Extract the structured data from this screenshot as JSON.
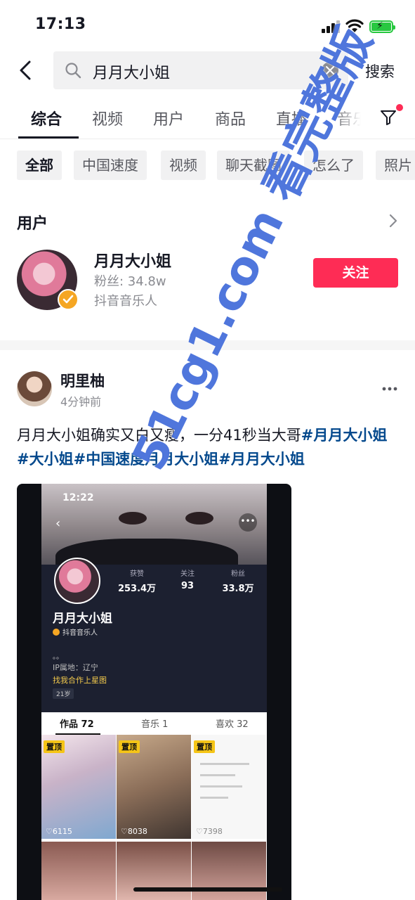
{
  "status_bar": {
    "time": "17:13"
  },
  "search": {
    "value": "月月大小姐",
    "button_label": "搜索"
  },
  "tabs": [
    {
      "label": "综合"
    },
    {
      "label": "视频"
    },
    {
      "label": "用户"
    },
    {
      "label": "商品"
    },
    {
      "label": "直播"
    },
    {
      "label": "音乐"
    }
  ],
  "chips": [
    {
      "label": "全部"
    },
    {
      "label": "中国速度"
    },
    {
      "label": "视频"
    },
    {
      "label": "聊天截图"
    },
    {
      "label": "怎么了"
    },
    {
      "label": "照片"
    }
  ],
  "user_section": {
    "title": "用户",
    "user": {
      "name": "月月大小姐",
      "fans": "粉丝: 34.8w",
      "tag": "抖音音乐人"
    },
    "follow_label": "关注"
  },
  "post": {
    "author": "明里柚",
    "time": "4分钟前",
    "caption_text": "月月大小姐确实又白又瘦，一分41秒当大哥",
    "hashtags": [
      "#月月大小姐",
      "#大小姐",
      "#中国速度月月大小姐",
      "#月月大小姐"
    ],
    "screenshot": {
      "time": "12:22",
      "stats": [
        {
          "label": "获赞",
          "value": "253.4万"
        },
        {
          "label": "关注",
          "value": "93"
        },
        {
          "label": "粉丝",
          "value": "33.8万"
        }
      ],
      "name": "月月大小姐",
      "tag": "抖音音乐人",
      "dots": "。。",
      "ip": "IP属地：辽宁",
      "link": "找我合作上星图",
      "age": "21岁",
      "tabs": [
        "作品 72",
        "音乐 1",
        "喜欢 32"
      ],
      "grid": [
        {
          "pin": "置顶",
          "likes": "♡6115"
        },
        {
          "pin": "置顶",
          "likes": "♡8038"
        },
        {
          "pin": "置顶",
          "likes": "♡7398"
        }
      ]
    }
  },
  "watermark": "51cg1.com 看完整版"
}
